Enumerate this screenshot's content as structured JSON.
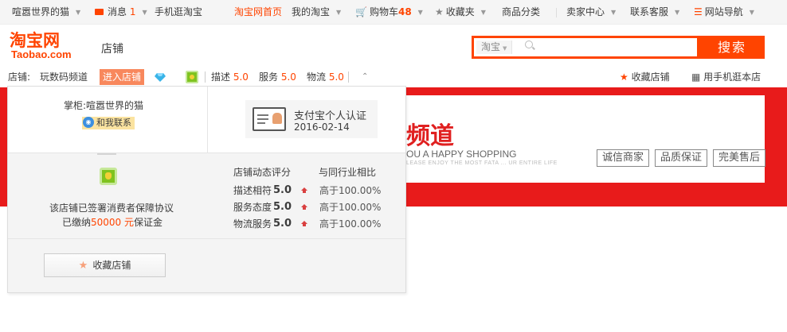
{
  "topbar": {
    "shop_name": "喧嚣世界的猫",
    "messages_label": "消息",
    "messages_count": "1",
    "mobile_taobao": "手机逛淘宝",
    "home": "淘宝网首页",
    "my_taobao": "我的淘宝",
    "cart_label": "购物车",
    "cart_count": "48",
    "favorites": "收藏夹",
    "categories": "商品分类",
    "seller_center": "卖家中心",
    "customer_service": "联系客服",
    "site_nav": "网站导航"
  },
  "header": {
    "logo_cn": "淘宝网",
    "logo_en": "Taobao.com",
    "shop_label": "店铺"
  },
  "search": {
    "category": "淘宝",
    "placeholder": "",
    "button_label": "搜索"
  },
  "shop_row": {
    "shop_prefix": "店铺:",
    "shop_name": "玩数码频道",
    "enter_shop": "进入店铺",
    "scores": [
      {
        "label": "描述",
        "value": "5.0"
      },
      {
        "label": "服务",
        "value": "5.0"
      },
      {
        "label": "物流",
        "value": "5.0"
      }
    ],
    "collect_shop": "收藏店铺",
    "mobile_shop": "用手机逛本店"
  },
  "banner": {
    "title": "频道",
    "subtitle": "OU A HAPPY SHOPPING",
    "small_text": "LEASE ENJOY THE MOST FATA ... UR ENTIRE LIFE",
    "tags": [
      "诚信商家",
      "品质保证",
      "完美售后"
    ]
  },
  "dropdown": {
    "keeper_label": "掌柜:",
    "keeper_name": "喧嚣世界的猫",
    "contact": "和我联系",
    "cert_title": "支付宝个人认证",
    "cert_date": "2016-02-14",
    "guarantee_line1": "该店铺已签署消费者保障协议",
    "guarantee_prefix": "已缴纳",
    "deposit": "50000 元",
    "guarantee_suffix": "保证金",
    "rating_header": "店铺动态评分",
    "compare_header": "与同行业相比",
    "ratings": [
      {
        "label": "描述相符",
        "score": "5.0",
        "compare": "高于100.00%"
      },
      {
        "label": "服务态度",
        "score": "5.0",
        "compare": "高于100.00%"
      },
      {
        "label": "物流服务",
        "score": "5.0",
        "compare": "高于100.00%"
      }
    ],
    "collect_button": "收藏店铺"
  },
  "colors": {
    "brand": "#ff4400",
    "banner_red": "#e81b1b",
    "enter_button": "#f8885d"
  }
}
